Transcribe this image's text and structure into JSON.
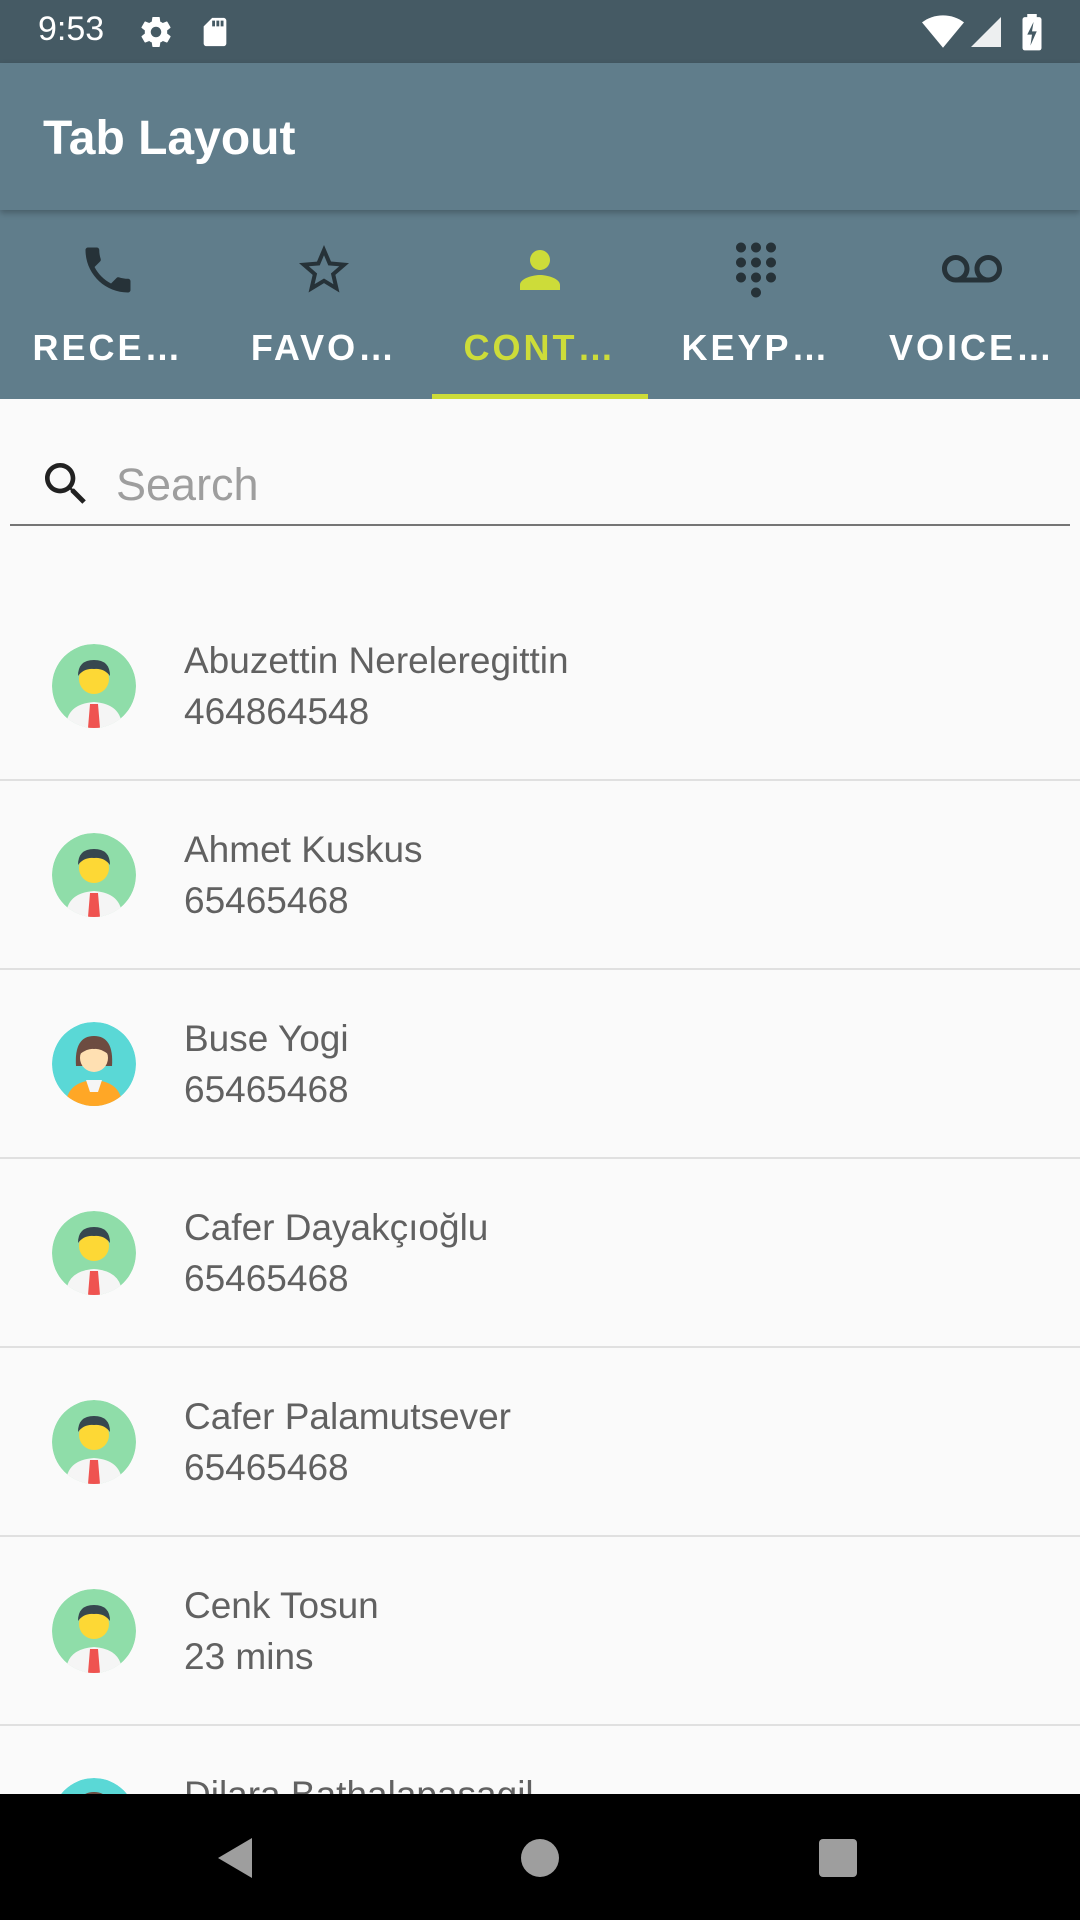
{
  "status_bar": {
    "time": "9:53",
    "icons": [
      "gear-icon",
      "sd-card-icon",
      "wifi-icon",
      "signal-icon",
      "battery-charging-icon"
    ]
  },
  "app_bar": {
    "title": "Tab Layout"
  },
  "tabs": [
    {
      "label": "RECE…",
      "icon": "phone-icon",
      "active": false
    },
    {
      "label": "FAVO…",
      "icon": "star-outline-icon",
      "active": false
    },
    {
      "label": "CONT…",
      "icon": "person-icon",
      "active": true
    },
    {
      "label": "KEYP…",
      "icon": "dialpad-icon",
      "active": false
    },
    {
      "label": "VOICE…",
      "icon": "voicemail-icon",
      "active": false
    }
  ],
  "search": {
    "placeholder": "Search",
    "value": ""
  },
  "contacts": [
    {
      "name": "Abuzettin Nereleregittin",
      "number": "464864548",
      "avatar": "male-avatar"
    },
    {
      "name": "Ahmet Kuskus",
      "number": "65465468",
      "avatar": "male-avatar"
    },
    {
      "name": "Buse Yogi",
      "number": "65465468",
      "avatar": "female-avatar"
    },
    {
      "name": "Cafer Dayakçıoğlu",
      "number": "65465468",
      "avatar": "male-avatar"
    },
    {
      "name": "Cafer Palamutsever",
      "number": "65465468",
      "avatar": "male-avatar"
    },
    {
      "name": "Cenk Tosun",
      "number": "23 mins",
      "avatar": "male-avatar"
    },
    {
      "name": "Dilara Bathalapaşagil",
      "number": "",
      "avatar": "female-avatar"
    }
  ],
  "colors": {
    "status_bar": "#455a64",
    "app_bar": "#607d8b",
    "accent": "#cddc39",
    "male_avatar_bg": "#8fdda9",
    "female_avatar_bg": "#5ad8d6"
  },
  "nav_bar": {
    "buttons": [
      "back-icon",
      "home-icon",
      "recents-icon"
    ]
  }
}
